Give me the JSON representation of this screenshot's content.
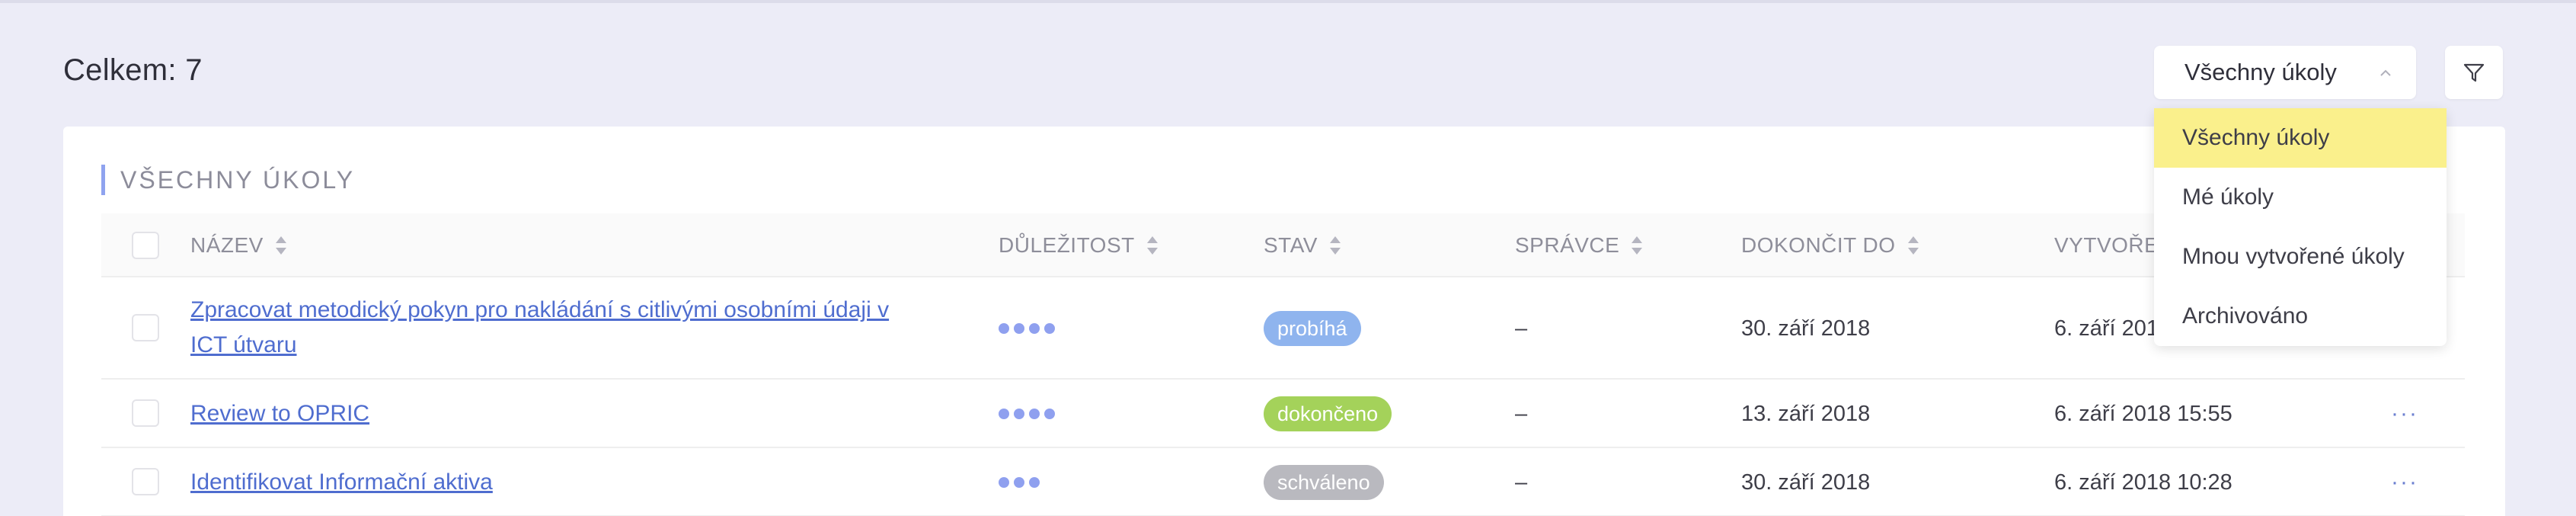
{
  "header": {
    "total_label": "Celkem: 7",
    "filter_select": {
      "value": "Všechny úkoly",
      "options": [
        "Všechny úkoly",
        "Mé úkoly",
        "Mnou vytvořené úkoly",
        "Archivováno"
      ],
      "highlight_color": "#faf08c"
    },
    "filter_icon": "funnel-icon"
  },
  "section": {
    "title": "VŠECHNY ÚKOLY"
  },
  "table": {
    "columns": {
      "name": "NÁZEV",
      "importance": "DŮLEŽITOST",
      "state": "STAV",
      "manager": "SPRÁVCE",
      "due": "DOKONČIT DO",
      "created": "VYTVOŘE"
    },
    "rows": [
      {
        "name_line1": "Zpracovat metodický pokyn pro nakládání s citlivými osobními údaji v",
        "name_line2": "ICT útvaru",
        "importance": 4,
        "state": "probíhá",
        "state_color": "#8fb4ee",
        "manager": "–",
        "due": "30. září 2018",
        "created": "6. září 201"
      },
      {
        "name_line1": "Review to OPRIC",
        "importance": 4,
        "state": "dokončeno",
        "state_color": "#a4d25a",
        "manager": "–",
        "due": "13. září 2018",
        "created": "6. září 2018 15:55",
        "more": "···"
      },
      {
        "name_line1": "Identifikovat Informační aktiva",
        "importance": 3,
        "state": "schváleno",
        "state_color": "#b9b9bf",
        "manager": "–",
        "due": "30. září 2018",
        "created": "6. září 2018 10:28",
        "more": "···"
      }
    ]
  },
  "colors": {
    "background": "#ececf7",
    "accent": "#8fa3ef",
    "link": "#4f6dcf"
  }
}
